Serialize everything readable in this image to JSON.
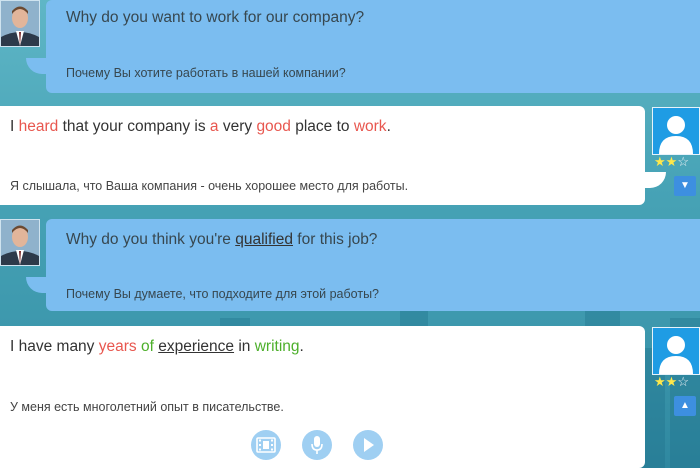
{
  "dialog": [
    {
      "question_en": "Why do you want to work for our company?",
      "question_ru": "Почему Вы хотите работать в нашей компании?",
      "answer_words": [
        {
          "text": "I ",
          "style": "plain"
        },
        {
          "text": "heard",
          "style": "red"
        },
        {
          "text": " that your company is ",
          "style": "plain"
        },
        {
          "text": "a",
          "style": "red"
        },
        {
          "text": " very ",
          "style": "plain"
        },
        {
          "text": "good",
          "style": "red"
        },
        {
          "text": " place to ",
          "style": "plain"
        },
        {
          "text": "work",
          "style": "red"
        },
        {
          "text": ".",
          "style": "plain"
        }
      ],
      "answer_ru": "Я слышала, что Ваша компания - очень хорошее место для работы.",
      "stars": "★★☆",
      "rating": 2,
      "toggle_icon": "▼"
    },
    {
      "question_en_parts": [
        {
          "text": "Why do you think you're ",
          "style": "plain"
        },
        {
          "text": "qualified",
          "style": "underline"
        },
        {
          "text": " for this job?",
          "style": "plain"
        }
      ],
      "question_ru": "Почему Вы думаете, что подходите для этой работы?",
      "answer_words": [
        {
          "text": "I have many ",
          "style": "plain"
        },
        {
          "text": "years",
          "style": "red"
        },
        {
          "text": " ",
          "style": "plain"
        },
        {
          "text": "of",
          "style": "green"
        },
        {
          "text": " ",
          "style": "plain"
        },
        {
          "text": "experience",
          "style": "underline"
        },
        {
          "text": " in ",
          "style": "plain"
        },
        {
          "text": "writing",
          "style": "green"
        },
        {
          "text": ".",
          "style": "plain"
        }
      ],
      "answer_ru": "У меня есть многолетний опыт в писательстве.",
      "stars": "★★☆",
      "rating": 2,
      "toggle_icon": "▲"
    }
  ],
  "controls": [
    {
      "name": "video",
      "icon": "film-icon"
    },
    {
      "name": "record",
      "icon": "microphone-icon"
    },
    {
      "name": "play",
      "icon": "play-icon"
    }
  ],
  "colors": {
    "question_bubble": "#7bbdf0",
    "answer_bubble": "#ffffff",
    "mistake_word": "#e8574f",
    "correct_word": "#4caf2a",
    "star_on": "#ffe84a"
  }
}
